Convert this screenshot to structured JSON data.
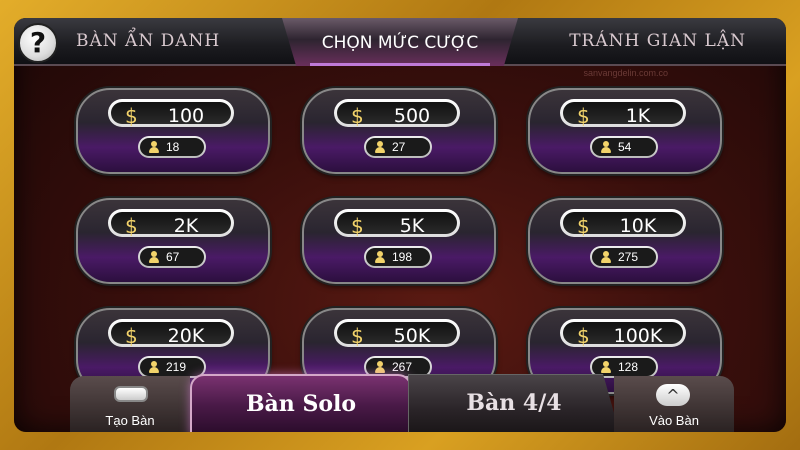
{
  "header": {
    "left_tab": "BÀN ẨN DANH",
    "center_tab": "CHỌN MỨC CƯỢC",
    "right_tab": "TRÁNH GIAN LẬN",
    "help_label": "?"
  },
  "watermark": "sanvangdelin.com.co",
  "currency_symbol": "$",
  "tables": [
    {
      "bet": "100",
      "players": "18"
    },
    {
      "bet": "500",
      "players": "27"
    },
    {
      "bet": "1K",
      "players": "54"
    },
    {
      "bet": "2K",
      "players": "67"
    },
    {
      "bet": "5K",
      "players": "198"
    },
    {
      "bet": "10K",
      "players": "275"
    },
    {
      "bet": "20K",
      "players": "219"
    },
    {
      "bet": "50K",
      "players": "267"
    },
    {
      "bet": "100K",
      "players": "128"
    }
  ],
  "footer": {
    "create_label": "Tạo Bàn",
    "solo_label": "Bàn Solo",
    "four_label": "Bàn 4/4",
    "join_label": "Vào Bàn",
    "join_icon": "^"
  },
  "colors": {
    "frame_gold": "#c8901c",
    "accent_purple": "#7a3270",
    "currency_gold": "#f2d36a"
  }
}
